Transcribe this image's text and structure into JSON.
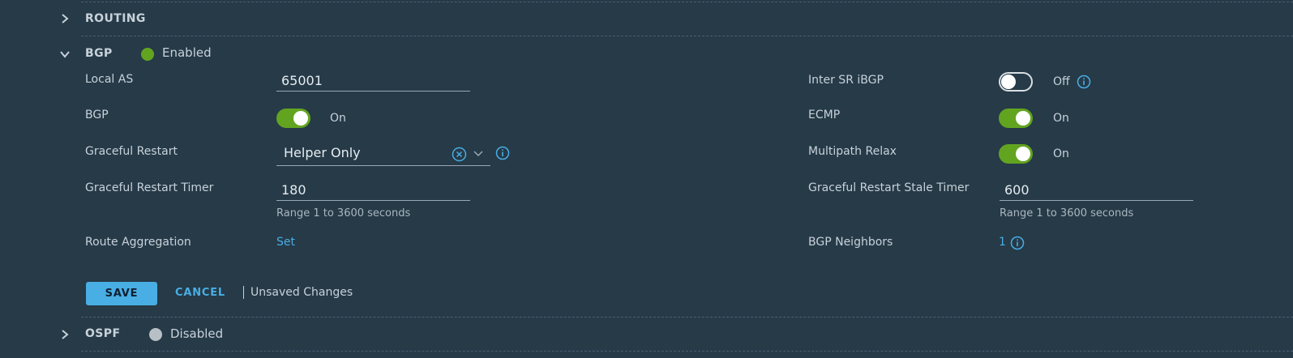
{
  "sections": {
    "routing": {
      "title": "ROUTING"
    },
    "bgp": {
      "title": "BGP",
      "status": "Enabled",
      "status_color": "#62a420"
    },
    "ospf": {
      "title": "OSPF",
      "status": "Disabled",
      "status_color": "#b8c0c6"
    }
  },
  "form": {
    "local_as": {
      "label": "Local AS",
      "value": "65001"
    },
    "bgp": {
      "label": "BGP",
      "state": "On"
    },
    "graceful_restart": {
      "label": "Graceful Restart",
      "value": "Helper Only"
    },
    "graceful_restart_timer": {
      "label": "Graceful Restart Timer",
      "value": "180",
      "hint": "Range 1 to 3600 seconds"
    },
    "route_aggregation": {
      "label": "Route Aggregation",
      "link": "Set"
    },
    "inter_sr_ibgp": {
      "label": "Inter SR iBGP",
      "state": "Off"
    },
    "ecmp": {
      "label": "ECMP",
      "state": "On"
    },
    "multipath_relax": {
      "label": "Multipath Relax",
      "state": "On"
    },
    "graceful_restart_stale_timer": {
      "label": "Graceful Restart Stale Timer",
      "value": "600",
      "hint": "Range 1 to 3600 seconds"
    },
    "bgp_neighbors": {
      "label": "BGP Neighbors",
      "count": "1"
    }
  },
  "actions": {
    "save": "SAVE",
    "cancel": "CANCEL",
    "unsaved": "Unsaved Changes"
  },
  "icons": {
    "chevron_right": "chevron-right-icon",
    "chevron_down": "chevron-down-icon",
    "info": "info-icon",
    "clear": "clear-icon"
  },
  "colors": {
    "background": "#263a48",
    "accent": "#49aee4",
    "toggle_on": "#62a420"
  }
}
